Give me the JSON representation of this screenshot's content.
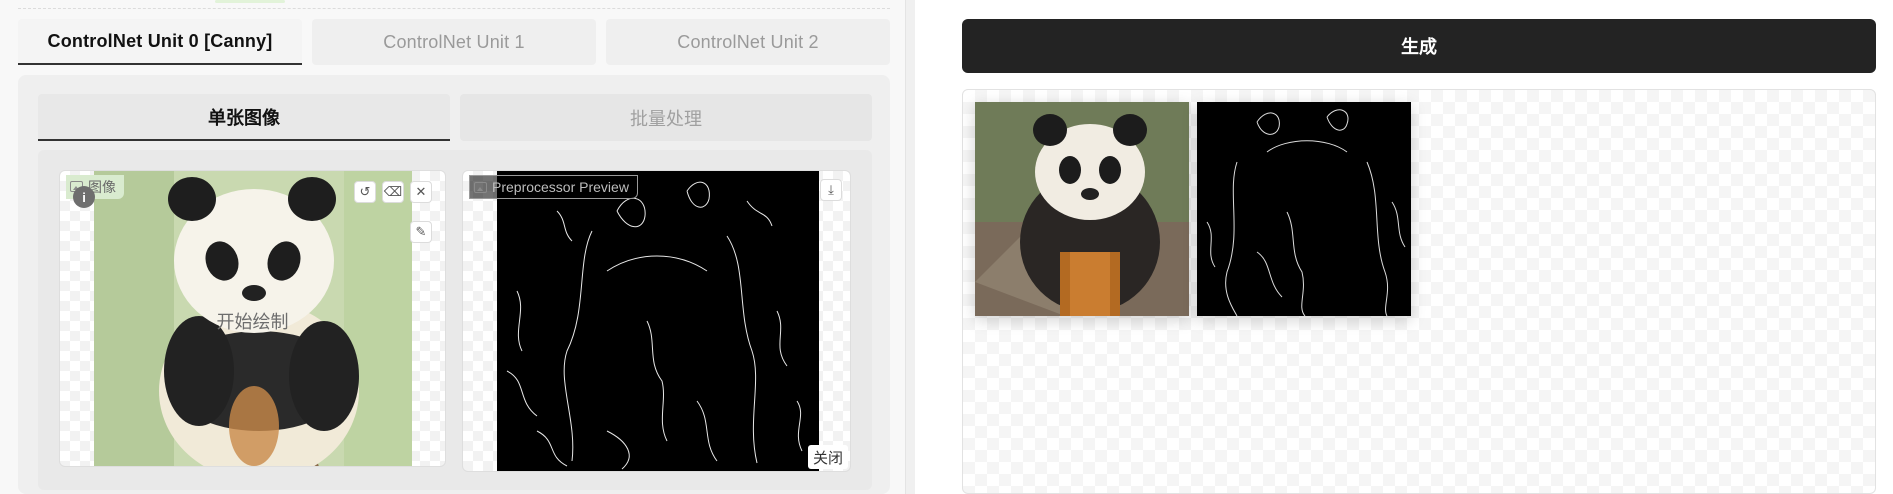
{
  "unit_tabs": [
    {
      "label": "ControlNet Unit 0 [Canny]",
      "active": true
    },
    {
      "label": "ControlNet Unit 1",
      "active": false
    },
    {
      "label": "ControlNet Unit 2",
      "active": false
    }
  ],
  "sub_tabs": [
    {
      "label": "单张图像",
      "active": true
    },
    {
      "label": "批量处理",
      "active": false
    }
  ],
  "input_box": {
    "label": "图像",
    "draw_hint": "开始绘制",
    "info_badge": "i",
    "tools": [
      "undo-icon",
      "eraser-icon",
      "close-icon",
      "brush-icon"
    ]
  },
  "preview_box": {
    "label": "Preprocessor Preview",
    "close_label": "关闭",
    "tools": [
      "download-icon"
    ]
  },
  "generate": {
    "label": "生成"
  },
  "gallery": {
    "items": [
      "panda-photo",
      "canny-edge-map"
    ]
  },
  "colors": {
    "accent_green": "#d9ebcf",
    "generate_bg": "#232323"
  }
}
